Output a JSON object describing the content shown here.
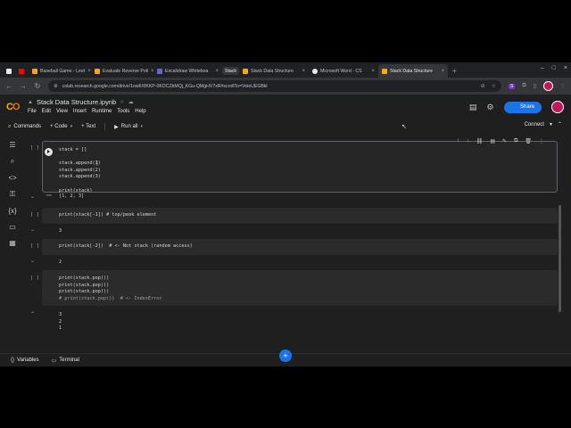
{
  "browser": {
    "tabs": [
      {
        "label": "",
        "color": "#e8eaed"
      },
      {
        "label": "",
        "color": "#ff0000"
      },
      {
        "label": "Baseball Game - Leet",
        "color": "#ffa116"
      },
      {
        "label": "Evaluate Reverse Poli",
        "color": "#ffa116"
      },
      {
        "label": "Excalidraw Whiteboa",
        "color": "#6965db"
      },
      {
        "label": "Stack",
        "color": ""
      },
      {
        "label": "Stack Data Structure",
        "color": "#f9ab00"
      },
      {
        "label": "Microsoft Word - CS",
        "color": "#e8eaed"
      },
      {
        "label": "Stack Data Structure",
        "color": "#f9ab00"
      }
    ],
    "url": "colab.research.google.com/drive/1ow6XfKKP-0KDCZbMQj_KGu-QMgHV7xR#scrollTo=VeieUEGBkl",
    "ext_label": "S"
  },
  "colab": {
    "notebook_title": "Stack Data Structure.ipynb",
    "menus": [
      "File",
      "Edit",
      "View",
      "Insert",
      "Runtime",
      "Tools",
      "Help"
    ],
    "share_label": "Share",
    "toolbar": {
      "commands": "Commands",
      "code": "+ Code",
      "text": "+ Text",
      "run_all": "Run all",
      "connect": "Connect"
    },
    "bottom": {
      "variables": "Variables",
      "terminal": "Terminal"
    }
  },
  "cells": [
    {
      "prompt": "[ ]",
      "output": "[1, 2, 3]"
    },
    {
      "prompt": "[ ]",
      "code": "print(stack[-1]) # top/peek element",
      "output": "3"
    },
    {
      "prompt": "[ ]",
      "code": "print(stack[-2])  # <- Not stack (random access)",
      "output": "2"
    },
    {
      "prompt": "[ ]",
      "output": "3\n2\n1"
    }
  ],
  "cell1_code": {
    "l1": "stack = []",
    "l3a": "stack.append(",
    "l3b": "1",
    "l3c": ")",
    "l4": "stack.append(2)",
    "l5": "stack.append(3)",
    "l7": "print(stack)"
  },
  "cell4_code": {
    "l1": "print(stack.pop())",
    "l2": "print(stack.pop())",
    "l3": "print(stack.pop())",
    "l4": "# print(stack.pop())  # <- IndexError"
  }
}
